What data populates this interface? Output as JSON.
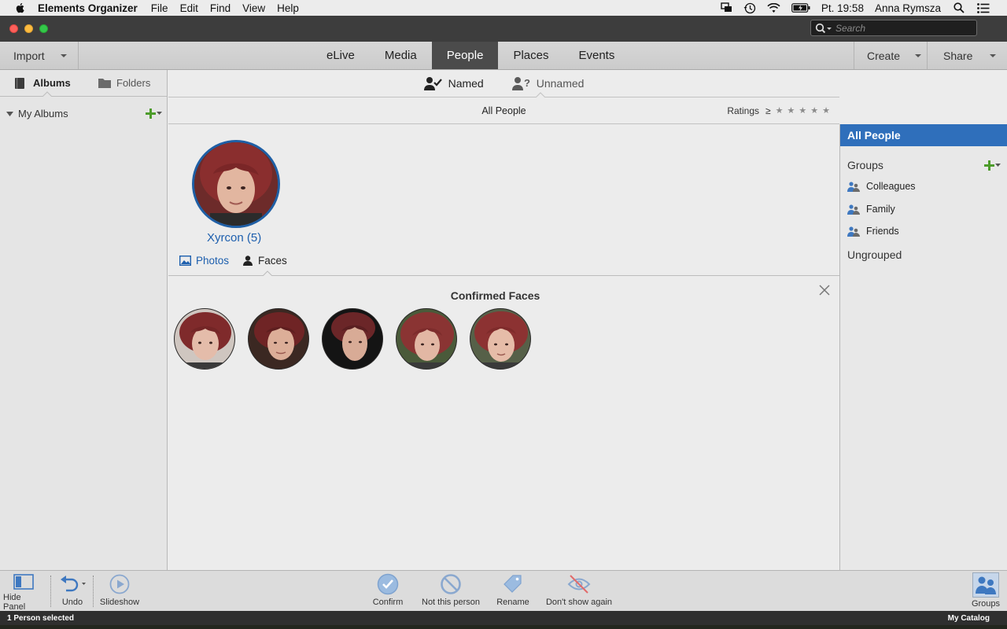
{
  "menubar": {
    "app_name": "Elements Organizer",
    "items": [
      "File",
      "Edit",
      "Find",
      "View",
      "Help"
    ],
    "clock": "Pt. 19:58",
    "user": "Anna Rymsza"
  },
  "titlebar": {
    "search_placeholder": "Search"
  },
  "topnav": {
    "import_label": "Import",
    "tabs": [
      "eLive",
      "Media",
      "People",
      "Places",
      "Events"
    ],
    "active_tab": "People",
    "create_label": "Create",
    "share_label": "Share"
  },
  "left_panel": {
    "tab_albums": "Albums",
    "tab_folders": "Folders",
    "my_albums": "My Albums"
  },
  "people_view": {
    "tab_named": "Named",
    "tab_unnamed": "Unnamed",
    "header": "All People",
    "ratings_label": "Ratings",
    "ratings_operator": "≥",
    "person_name": "Xyrcon (5)",
    "tab_photos": "Photos",
    "tab_faces": "Faces",
    "confirmed_title": "Confirmed Faces",
    "faces_count": 5
  },
  "right_panel": {
    "all_people": "All People",
    "groups_label": "Groups",
    "groups": [
      "Colleagues",
      "Family",
      "Friends"
    ],
    "ungrouped": "Ungrouped"
  },
  "bottom_toolbar": {
    "hide_panel": "Hide Panel",
    "undo": "Undo",
    "slideshow": "Slideshow",
    "confirm": "Confirm",
    "not_this_person": "Not this person",
    "rename": "Rename",
    "dont_show_again": "Don't show again",
    "groups": "Groups"
  },
  "statusbar": {
    "selection": "1 Person selected",
    "catalog": "My Catalog"
  },
  "colors": {
    "accent_blue": "#2f6fbb",
    "name_blue": "#1d5fae",
    "dark_chrome": "#3d3d3d",
    "active_tab_bg": "#4b4b4b"
  }
}
